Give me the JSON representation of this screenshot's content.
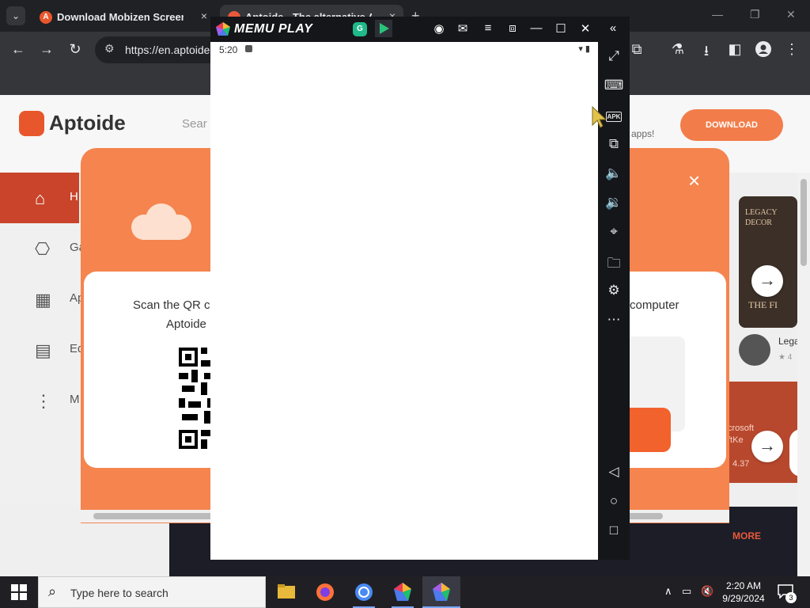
{
  "browser": {
    "tabs": [
      {
        "title": "Download Mobizen Screen Re",
        "favicon": "A",
        "close": "×"
      },
      {
        "title": "Aptoide - The alternative And",
        "close": "×"
      }
    ],
    "new_tab": "+",
    "window_controls": {
      "minimize": "—",
      "restore": "❐",
      "close": "✕"
    },
    "tab_menu": "⌄",
    "url": "https://en.aptoide"
  },
  "aptoide": {
    "logo": "Aptoide",
    "search_placeholder": "Sear",
    "apps_text": "apps!",
    "download_label": "DOWNLOAD",
    "sidebar": [
      {
        "label": "H",
        "icon": "⌂"
      },
      {
        "label": "Ga",
        "icon": "⎔"
      },
      {
        "label": "Ap",
        "icon": "▦"
      },
      {
        "label": "Ed",
        "icon": "▤"
      },
      {
        "label": "M",
        "icon": "⋮"
      }
    ],
    "more_label": "MORE",
    "right_card": {
      "text": "LEGACY\nDECOR",
      "bottom": "THE FI",
      "legacy_label": "Lega",
      "legacy_rating": "★ 4",
      "ms_text": "crosoft\nftKe",
      "ms_rating": "4.37"
    }
  },
  "modal": {
    "close": "×",
    "qr_line1": "Scan the QR c",
    "qr_line2": "Aptoide",
    "computer_text": "computer"
  },
  "memu": {
    "title": "MEMU PLAY",
    "app1_letter": "G",
    "status_time": "5:20",
    "status_right": "▾ ▮"
  },
  "taskbar": {
    "search_placeholder": "Type here to search",
    "time": "2:20 AM",
    "date": "9/29/2024",
    "notification_count": "3"
  }
}
